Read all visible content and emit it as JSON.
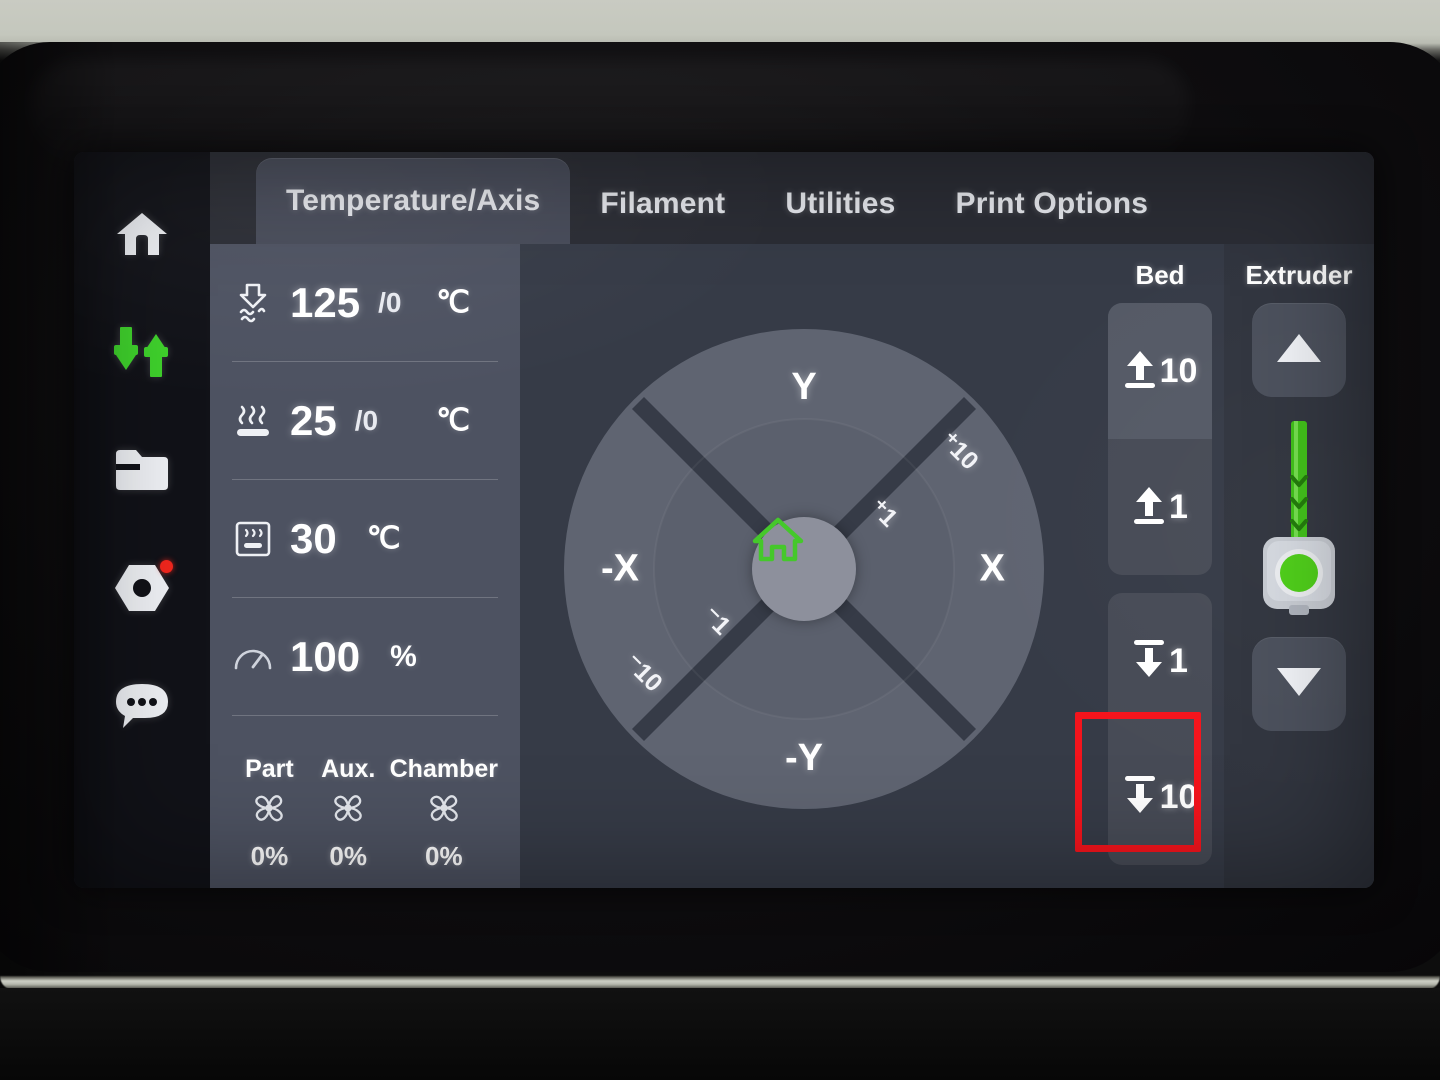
{
  "sidebar": {
    "items": [
      {
        "name": "home",
        "icon": "home-icon",
        "active": false
      },
      {
        "name": "control",
        "icon": "sliders-icon",
        "active": true
      },
      {
        "name": "files",
        "icon": "folder-icon",
        "active": false
      },
      {
        "name": "settings",
        "icon": "nut-gear-icon",
        "active": false,
        "badge": true
      },
      {
        "name": "messages",
        "icon": "chat-bubble-icon",
        "active": false
      }
    ]
  },
  "tabs": [
    {
      "label": "Temperature/Axis",
      "active": true
    },
    {
      "label": "Filament",
      "active": false
    },
    {
      "label": "Utilities",
      "active": false
    },
    {
      "label": "Print Options",
      "active": false
    }
  ],
  "status": {
    "nozzle": {
      "icon": "nozzle-icon",
      "current": "125",
      "target": "/0",
      "unit": "℃"
    },
    "bed": {
      "icon": "heated-bed-icon",
      "current": "25",
      "target": "/0",
      "unit": "℃"
    },
    "chamber": {
      "icon": "chamber-icon",
      "current": "30",
      "unit": "℃"
    },
    "speed": {
      "icon": "speed-gauge-icon",
      "value": "100",
      "unit": "%"
    },
    "fans": [
      {
        "label": "Part",
        "value": "0%",
        "icon": "fan-icon"
      },
      {
        "label": "Aux.",
        "value": "0%",
        "icon": "fan-icon"
      },
      {
        "label": "Chamber",
        "value": "0%",
        "icon": "fan-icon"
      }
    ]
  },
  "jog": {
    "axis_up": "Y",
    "axis_down": "-Y",
    "axis_right": "X",
    "axis_left": "-X",
    "step_plus10": "⁺10",
    "step_plus1": "⁺1",
    "step_minus1": "⁻1",
    "step_minus10": "⁻10",
    "home_icon": "home-icon",
    "home_color": "#45c82b"
  },
  "bed_controls": {
    "title": "Bed",
    "buttons": [
      {
        "label": "10",
        "direction": "up",
        "icon": "arrow-up-to-bar-icon",
        "highlighted": true
      },
      {
        "label": "1",
        "direction": "up",
        "icon": "arrow-up-to-bar-icon",
        "highlighted": false
      },
      {
        "label": "1",
        "direction": "down",
        "icon": "arrow-down-to-bar-icon",
        "highlighted": false
      },
      {
        "label": "10",
        "direction": "down",
        "icon": "arrow-down-to-bar-icon",
        "highlighted": false
      }
    ]
  },
  "extruder_controls": {
    "title": "Extruder",
    "up_icon": "triangle-up-icon",
    "down_icon": "triangle-down-icon",
    "graphic_icon": "extruder-filament-icon",
    "filament_color": "#3fc017"
  },
  "annotation": {
    "target": "bed-down-10-button",
    "color": "#f4141c"
  }
}
